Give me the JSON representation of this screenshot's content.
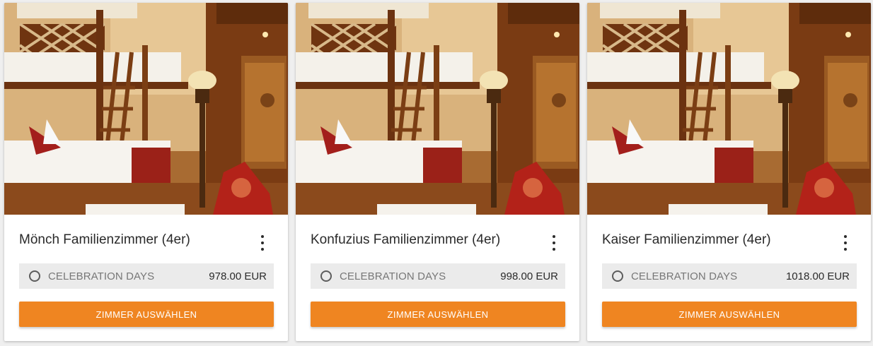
{
  "colors": {
    "accent": "#ef8521",
    "rate_bg": "#ebebeb",
    "page_bg": "#efefef"
  },
  "rooms": [
    {
      "title": "Mönch Familienzimmer (4er)",
      "rate_name": "CELEBRATION DAYS",
      "price": "978.00 EUR",
      "button_label": "ZIMMER AUSWÄHLEN",
      "menu_icon": "more-vert-icon",
      "radio_selected": false
    },
    {
      "title": "Konfuzius Familienzimmer (4er)",
      "rate_name": "CELEBRATION DAYS",
      "price": "998.00 EUR",
      "button_label": "ZIMMER AUSWÄHLEN",
      "menu_icon": "more-vert-icon",
      "radio_selected": false
    },
    {
      "title": "Kaiser Familienzimmer (4er)",
      "rate_name": "CELEBRATION DAYS",
      "price": "1018.00 EUR",
      "button_label": "ZIMMER AUSWÄHLEN",
      "menu_icon": "more-vert-icon",
      "radio_selected": false
    }
  ]
}
